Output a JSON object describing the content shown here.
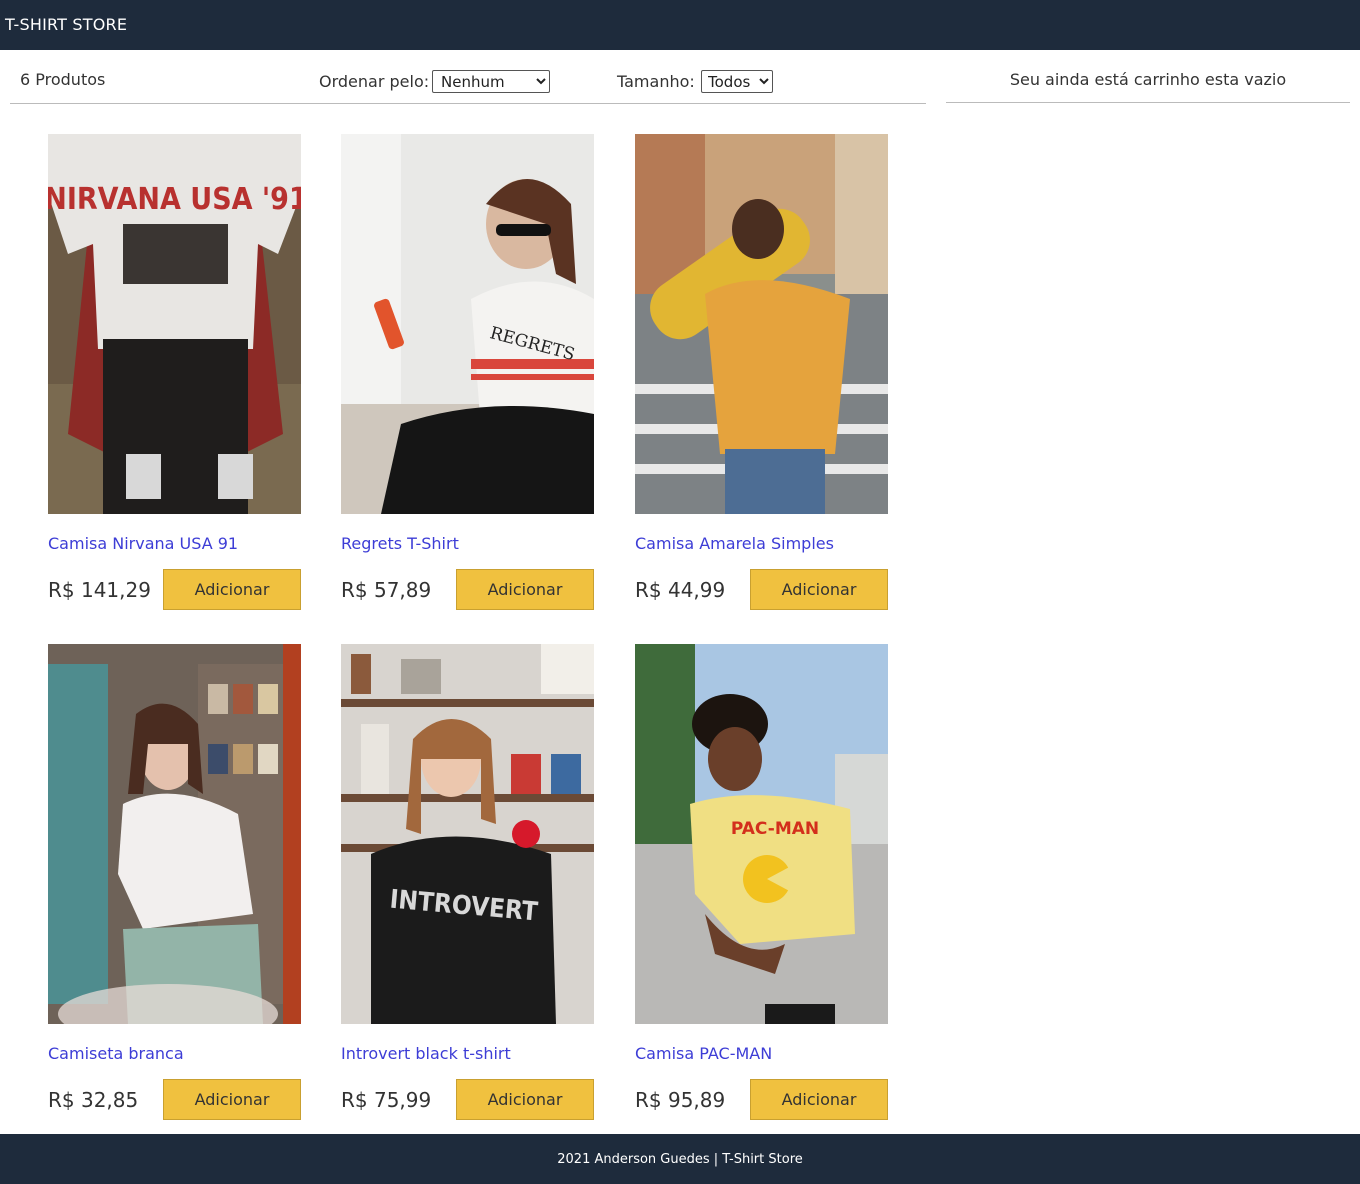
{
  "header": {
    "title": "T-SHIRT STORE"
  },
  "filters": {
    "count_label": "6 Produtos",
    "sort_label": "Ordenar pelo:",
    "sort_value": "Nenhum",
    "size_label": "Tamanho:",
    "size_value": "Todos"
  },
  "cart": {
    "empty_message": "Seu ainda está carrinho esta vazio"
  },
  "products": [
    {
      "name": "Camisa Nirvana USA 91",
      "price": "R$ 141,29",
      "button": "Adicionar",
      "shirt_print": "NIRVANA USA '91"
    },
    {
      "name": "Regrets T-Shirt",
      "price": "R$ 57,89",
      "button": "Adicionar",
      "shirt_print": "REGRETS"
    },
    {
      "name": "Camisa Amarela Simples",
      "price": "R$ 44,99",
      "button": "Adicionar",
      "shirt_print": ""
    },
    {
      "name": "Camiseta branca",
      "price": "R$ 32,85",
      "button": "Adicionar",
      "shirt_print": ""
    },
    {
      "name": "Introvert black t-shirt",
      "price": "R$ 75,99",
      "button": "Adicionar",
      "shirt_print": "INTROVERT"
    },
    {
      "name": "Camisa PAC-MAN",
      "price": "R$ 95,89",
      "button": "Adicionar",
      "shirt_print": "PAC-MAN"
    }
  ],
  "footer": {
    "text": "2021 Anderson Guedes | T-Shirt Store"
  },
  "colors": {
    "navbar": "#1e2b3c",
    "button": "#f0c13f",
    "product_link": "#3d3dd6"
  }
}
